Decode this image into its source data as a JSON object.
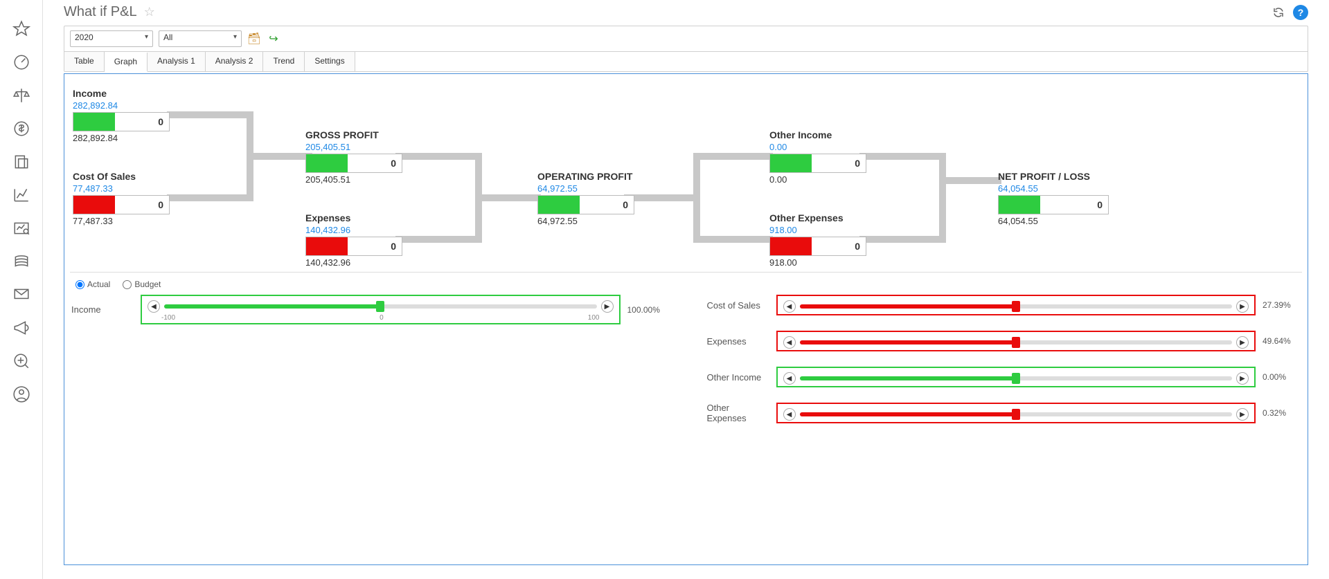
{
  "header": {
    "title": "What if P&L"
  },
  "toolbar": {
    "year": "2020",
    "scope": "All"
  },
  "tabs": [
    "Table",
    "Graph",
    "Analysis 1",
    "Analysis 2",
    "Trend",
    "Settings"
  ],
  "active_tab": "Graph",
  "nodes": {
    "income": {
      "title": "Income",
      "blue": "282,892.84",
      "delta": "0",
      "bottom": "282,892.84",
      "color": "green"
    },
    "cos": {
      "title": "Cost Of Sales",
      "blue": "77,487.33",
      "delta": "0",
      "bottom": "77,487.33",
      "color": "red"
    },
    "gross": {
      "title": "GROSS PROFIT",
      "blue": "205,405.51",
      "delta": "0",
      "bottom": "205,405.51",
      "color": "green"
    },
    "expenses": {
      "title": "Expenses",
      "blue": "140,432.96",
      "delta": "0",
      "bottom": "140,432.96",
      "color": "red"
    },
    "operating": {
      "title": "OPERATING PROFIT",
      "blue": "64,972.55",
      "delta": "0",
      "bottom": "64,972.55",
      "color": "green"
    },
    "other_income": {
      "title": "Other Income",
      "blue": "0.00",
      "delta": "0",
      "bottom": "0.00",
      "color": "green"
    },
    "other_exp": {
      "title": "Other Expenses",
      "blue": "918.00",
      "delta": "0",
      "bottom": "918.00",
      "color": "red"
    },
    "net": {
      "title": "NET PROFIT / LOSS",
      "blue": "64,054.55",
      "delta": "0",
      "bottom": "64,054.55",
      "color": "green"
    }
  },
  "radio": {
    "actual": "Actual",
    "budget": "Budget"
  },
  "sliders": {
    "income": {
      "label": "Income",
      "pct": "100.00%",
      "color": "g",
      "ticks": [
        "-100",
        "0",
        "100"
      ]
    },
    "cos": {
      "label": "Cost of Sales",
      "pct": "27.39%",
      "color": "r"
    },
    "expenses": {
      "label": "Expenses",
      "pct": "49.64%",
      "color": "r"
    },
    "other_income": {
      "label": "Other Income",
      "pct": "0.00%",
      "color": "g"
    },
    "other_exp": {
      "label": "Other Expenses",
      "pct": "0.32%",
      "color": "r"
    }
  },
  "chart_data": {
    "type": "diagram",
    "description": "P&L waterfall flow: Income − Cost Of Sales → Gross Profit; Gross Profit − Expenses → Operating Profit; Operating Profit + Other Income − Other Expenses → Net Profit/Loss.",
    "nodes": [
      {
        "id": "income",
        "label": "Income",
        "actual": 282892.84,
        "delta": 0,
        "sign": "pos"
      },
      {
        "id": "cos",
        "label": "Cost Of Sales",
        "actual": 77487.33,
        "delta": 0,
        "sign": "neg"
      },
      {
        "id": "gross",
        "label": "GROSS PROFIT",
        "actual": 205405.51,
        "delta": 0,
        "sign": "pos"
      },
      {
        "id": "expenses",
        "label": "Expenses",
        "actual": 140432.96,
        "delta": 0,
        "sign": "neg"
      },
      {
        "id": "operating",
        "label": "OPERATING PROFIT",
        "actual": 64972.55,
        "delta": 0,
        "sign": "pos"
      },
      {
        "id": "other_income",
        "label": "Other Income",
        "actual": 0.0,
        "delta": 0,
        "sign": "pos"
      },
      {
        "id": "other_exp",
        "label": "Other Expenses",
        "actual": 918.0,
        "delta": 0,
        "sign": "neg"
      },
      {
        "id": "net",
        "label": "NET PROFIT / LOSS",
        "actual": 64054.55,
        "delta": 0,
        "sign": "pos"
      }
    ],
    "edges": [
      [
        "income",
        "gross"
      ],
      [
        "cos",
        "gross"
      ],
      [
        "gross",
        "operating"
      ],
      [
        "expenses",
        "operating"
      ],
      [
        "operating",
        "net"
      ],
      [
        "other_income",
        "net"
      ],
      [
        "other_exp",
        "net"
      ]
    ],
    "what_if_sliders": {
      "Income": 100.0,
      "Cost of Sales": 27.39,
      "Expenses": 49.64,
      "Other Income": 0.0,
      "Other Expenses": 0.32
    }
  }
}
